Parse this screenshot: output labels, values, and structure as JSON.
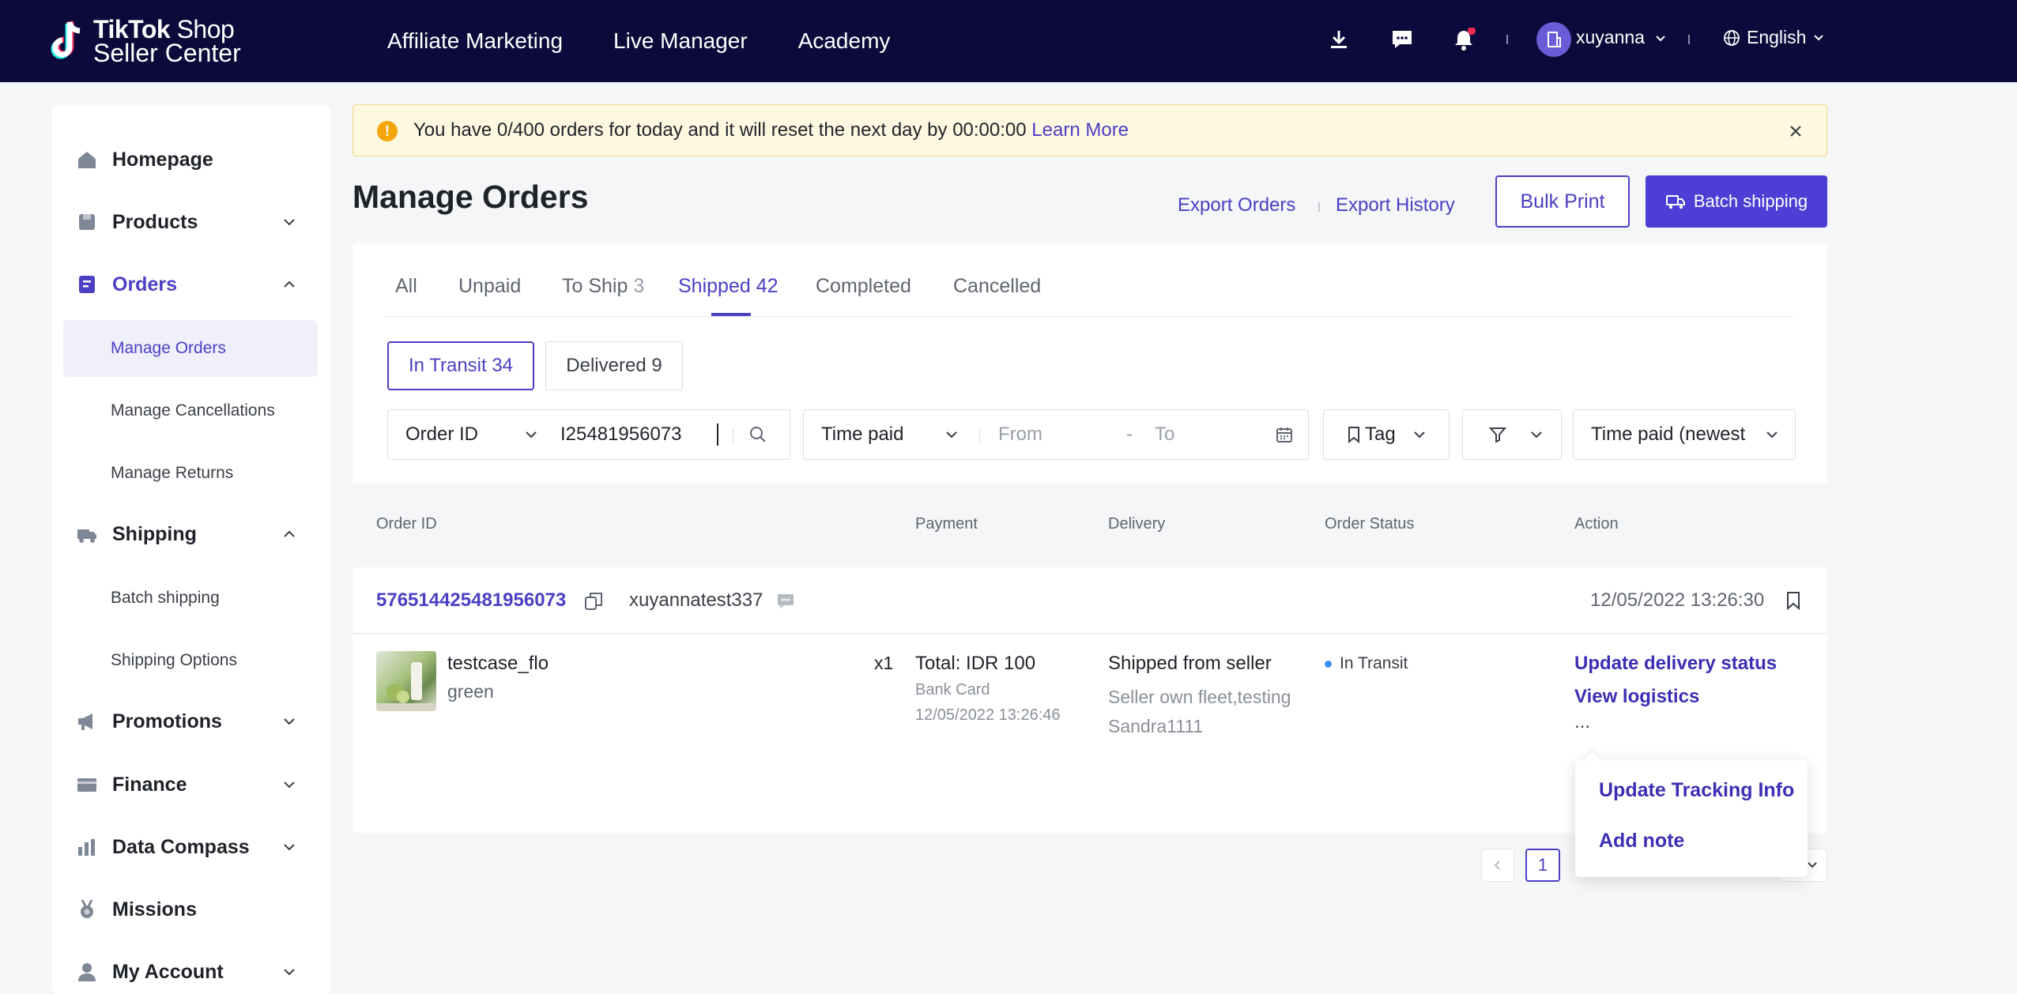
{
  "brand": {
    "logo_line1": "TikTok",
    "logo_line1b": "Shop",
    "logo_line2": "Seller Center"
  },
  "topnav": [
    "Affiliate Marketing",
    "Live Manager",
    "Academy"
  ],
  "user": {
    "name": "xuyanna",
    "language": "English"
  },
  "sidebar": {
    "items": [
      {
        "label": "Homepage",
        "icon": "home-icon"
      },
      {
        "label": "Products",
        "icon": "box-icon"
      },
      {
        "label": "Orders",
        "icon": "orders-icon"
      },
      {
        "label": "Shipping",
        "icon": "truck-icon"
      },
      {
        "label": "Promotions",
        "icon": "megaphone-icon"
      },
      {
        "label": "Finance",
        "icon": "card-icon"
      },
      {
        "label": "Data Compass",
        "icon": "chart-icon"
      },
      {
        "label": "Missions",
        "icon": "medal-icon"
      },
      {
        "label": "My Account",
        "icon": "person-icon"
      }
    ],
    "orders_sub": [
      "Manage Orders",
      "Manage Cancellations",
      "Manage Returns"
    ],
    "shipping_sub": [
      "Batch shipping",
      "Shipping Options"
    ]
  },
  "notice": {
    "icon_text": "!",
    "text": "You have 0/400 orders for today and it will reset the next day by 00:00:00 ",
    "link": "Learn More"
  },
  "page": {
    "title": "Manage Orders",
    "export_orders": "Export Orders",
    "export_history": "Export History",
    "bulk_print": "Bulk Print",
    "batch_shipping": "Batch shipping"
  },
  "tabs": [
    {
      "label": "All",
      "count": ""
    },
    {
      "label": "Unpaid",
      "count": ""
    },
    {
      "label": "To Ship",
      "count": "3"
    },
    {
      "label": "Shipped",
      "count": "42"
    },
    {
      "label": "Completed",
      "count": ""
    },
    {
      "label": "Cancelled",
      "count": ""
    }
  ],
  "subtabs": [
    "In Transit 34",
    "Delivered 9"
  ],
  "filters": {
    "search_type": "Order ID",
    "search_value": "I25481956073",
    "time_type": "Time paid",
    "from": "From",
    "dash": "-",
    "to": "To",
    "tag": "Tag",
    "sort": "Time paid (newest"
  },
  "table_headers": [
    "Order ID",
    "Payment",
    "Delivery",
    "Order Status",
    "Action"
  ],
  "order": {
    "id": "576514425481956073",
    "buyer": "xuyannatest337",
    "time": "12/05/2022 13:26:30",
    "product": "testcase_flo",
    "variant": "green",
    "qty": "x1",
    "total": "Total: IDR 100",
    "method": "Bank Card",
    "paid_time": "12/05/2022 13:26:46",
    "delivery": "Shipped from seller",
    "delivery_detail1": "Seller own fleet,testing",
    "delivery_detail2": "Sandra1111",
    "status": "In Transit",
    "actions": [
      "Update delivery status",
      "View logistics"
    ],
    "more": "..."
  },
  "popup": [
    "Update Tracking Info",
    "Add note"
  ],
  "pager": {
    "page": "1"
  },
  "colors": {
    "accent": "#4b3fc4",
    "topbar": "#0b0a3a",
    "notice_bg": "#fff8e1"
  }
}
